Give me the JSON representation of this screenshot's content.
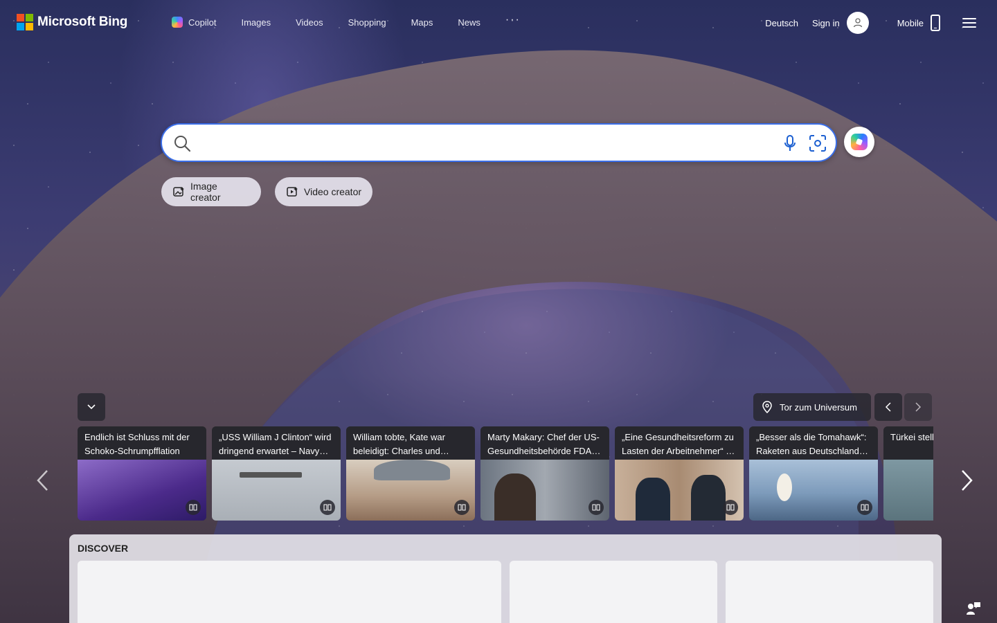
{
  "brand": {
    "name": "Microsoft Bing",
    "logo_colors": [
      "#f25022",
      "#7fba00",
      "#00a4ef",
      "#ffb900"
    ]
  },
  "nav": {
    "items": [
      {
        "label": "Copilot",
        "icon": "copilot-icon"
      },
      {
        "label": "Images"
      },
      {
        "label": "Videos"
      },
      {
        "label": "Shopping"
      },
      {
        "label": "Maps"
      },
      {
        "label": "News"
      }
    ],
    "more_label": "···"
  },
  "header_right": {
    "language": "Deutsch",
    "sign_in": "Sign in",
    "mobile": "Mobile"
  },
  "search": {
    "value": "",
    "placeholder": "",
    "accent": "#3a6ee8"
  },
  "creators": {
    "image_label": "Image creator",
    "video_label": "Video creator"
  },
  "image_of_day": {
    "location_label": "Tor zum Universum"
  },
  "news": [
    {
      "title": "Endlich ist Schluss mit der Schoko-Schrumpfflation",
      "thumb": "#6a3fa0"
    },
    {
      "title": "„USS William J Clinton“ wird dringend erwartet – Navy…",
      "thumb": "#b7bcc2"
    },
    {
      "title": "William tobte, Kate war beleidigt: Charles und…",
      "thumb": "#c9b8a6"
    },
    {
      "title": "Marty Makary: Chef der US-Gesundheitsbehörde FDA…",
      "thumb": "#8a8f98"
    },
    {
      "title": "„Eine Gesundheitsreform zu Lasten der Arbeitnehmer“ …",
      "thumb": "#b9a08a"
    },
    {
      "title": "„Besser als die Tomahawk“: Raketen aus Deutschland…",
      "thumb": "#8fa9c4"
    },
    {
      "title": "Türkei stellt Mini-U-Boot…",
      "thumb": "#6f8891"
    }
  ],
  "discover": {
    "title": "DISCOVER"
  }
}
